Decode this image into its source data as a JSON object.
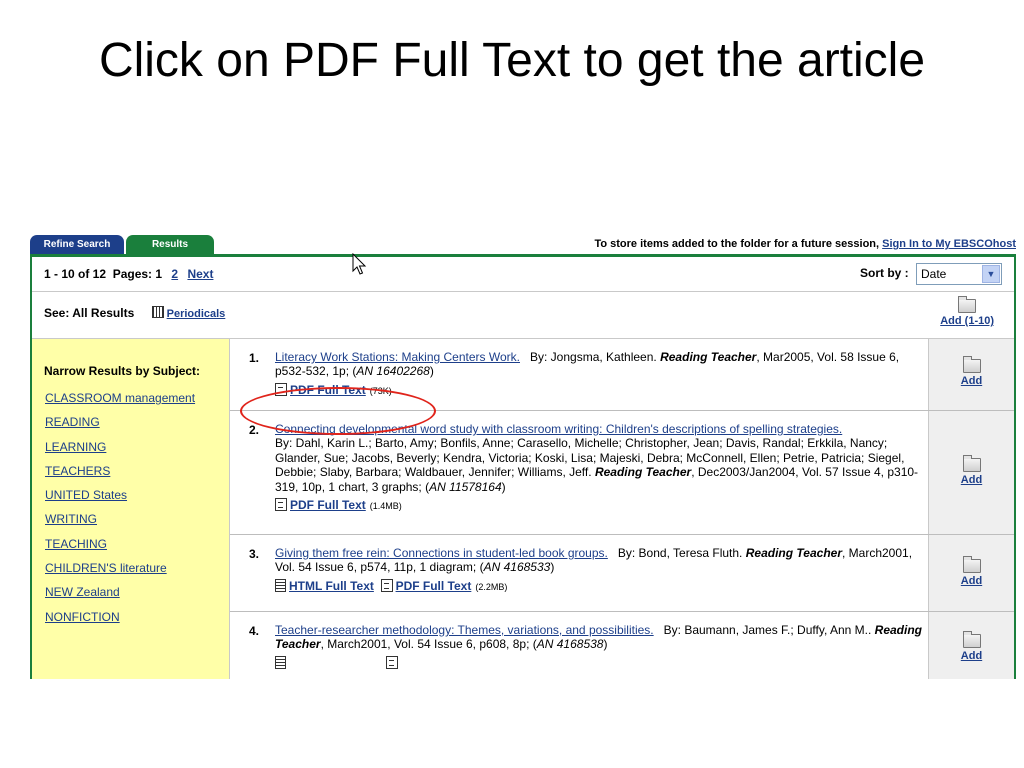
{
  "slide": {
    "title": "Click on PDF Full Text to get the article"
  },
  "tabs": [
    {
      "label": "Refine Search"
    },
    {
      "label": "Results"
    }
  ],
  "folder_note": {
    "text": "To store items added to the folder for a future session,",
    "link": "Sign In to My EBSCOhost"
  },
  "pager": {
    "summary": "1 - 10 of 12",
    "pages_label": "Pages: 1",
    "page2": "2",
    "next": "Next"
  },
  "sort": {
    "label": "Sort by :",
    "value": "Date"
  },
  "see": {
    "label": "See: All Results",
    "periodicals": "Periodicals"
  },
  "add_all": "Add (1-10)",
  "narrow": {
    "title": "Narrow Results by Subject:",
    "subjects": [
      "CLASSROOM management",
      "READING",
      "LEARNING",
      "TEACHERS",
      "UNITED States",
      "WRITING",
      "TEACHING",
      "CHILDREN'S literature",
      "NEW Zealand",
      "NONFICTION"
    ]
  },
  "results": [
    {
      "num": "1.",
      "title": "Literacy Work Stations: Making Centers Work.",
      "authors": "By: Jongsma, Kathleen.",
      "journal": "Reading Teacher",
      "details": ", Mar2005, Vol. 58 Issue 6, p532-532, 1p; (",
      "an_prefix": "AN",
      "an": "16402268",
      "close": ")",
      "pdf_label": "PDF Full Text",
      "pdf_size": "(73K)",
      "add": "Add"
    },
    {
      "num": "2.",
      "title": "Connecting developmental word study with classroom writing: Children's descriptions of spelling strategies.",
      "authors": "By: Dahl, Karin L.; Barto, Amy; Bonfils, Anne; Carasello, Michelle; Christopher, Jean; Davis, Randal; Erkkila, Nancy; Glander, Sue; Jacobs, Beverly; Kendra, Victoria; Koski, Lisa; Majeski, Debra; McConnell, Ellen; Petrie, Patricia; Siegel, Debbie; Slaby, Barbara; Waldbauer, Jennifer; Williams, Jeff.",
      "journal": "Reading Teacher",
      "details": ", Dec2003/Jan2004, Vol. 57 Issue 4, p310-319, 10p, 1 chart, 3 graphs; (",
      "an_prefix": "AN",
      "an": "11578164",
      "close": ")",
      "pdf_label": "PDF Full Text",
      "pdf_size": "(1.4MB)",
      "add": "Add"
    },
    {
      "num": "3.",
      "title": "Giving them free rein: Connections in student-led book groups.",
      "authors": "By: Bond, Teresa Fluth.",
      "journal": "Reading Teacher",
      "details": ", March2001, Vol. 54 Issue 6, p574, 11p, 1 diagram; (",
      "an_prefix": "AN",
      "an": "4168533",
      "close": ")",
      "html_label": "HTML Full Text",
      "pdf_label": "PDF Full Text",
      "pdf_size": "(2.2MB)",
      "add": "Add"
    },
    {
      "num": "4.",
      "title": "Teacher-researcher methodology: Themes, variations, and possibilities.",
      "authors": "By: Baumann, James F.; Duffy, Ann M..",
      "journal": "Reading Teacher",
      "details": ", March2001, Vol. 54 Issue 6, p608, 8p; (",
      "an_prefix": "AN",
      "an": "4168538",
      "close": ")",
      "add": "Add"
    }
  ],
  "colors": {
    "tab_blue": "#1d3f8a",
    "tab_green": "#1a7f3c",
    "sidebar_bg": "#ffffa8",
    "annotation_red": "#e0241b"
  }
}
